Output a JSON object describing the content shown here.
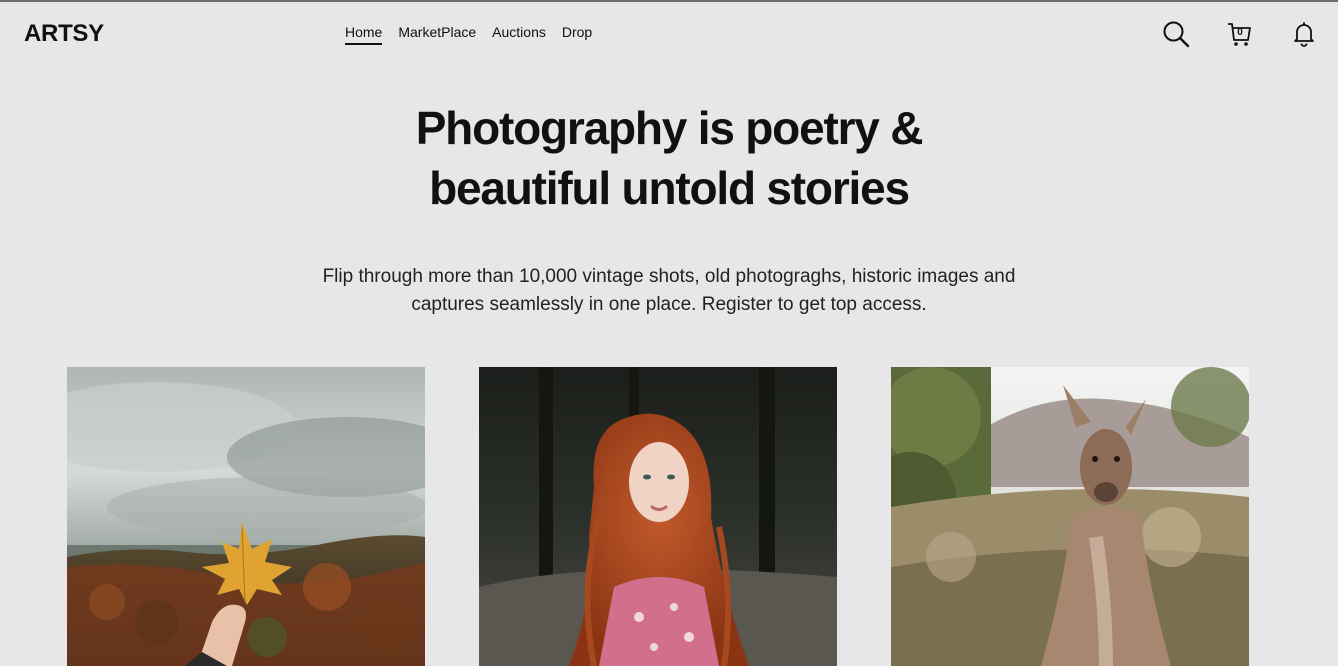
{
  "brand": {
    "name": "ARTSY"
  },
  "nav": {
    "items": [
      {
        "label": "Home",
        "active": true
      },
      {
        "label": "MarketPlace",
        "active": false
      },
      {
        "label": "Auctions",
        "active": false
      },
      {
        "label": "Drop",
        "active": false
      }
    ]
  },
  "header_icons": {
    "search": "search-icon",
    "cart": "cart-icon",
    "cart_count": "0",
    "bell": "bell-icon"
  },
  "hero": {
    "title_line1": "Photography is poetry &",
    "title_line2": "beautiful untold stories",
    "subtitle_line1": "Flip through more than 10,000 vintage shots, old photograghs, historic images and",
    "subtitle_line2": "captures seamlessly in one place. Register to get top access."
  },
  "gallery": {
    "images": [
      {
        "subject": "autumn-maple-leaf-landscape"
      },
      {
        "subject": "red-haired-woman-portrait"
      },
      {
        "subject": "kangaroo-in-field"
      }
    ]
  },
  "colors": {
    "background": "#e7e7ea",
    "text": "#111111",
    "top_border": "#6e6e70"
  }
}
